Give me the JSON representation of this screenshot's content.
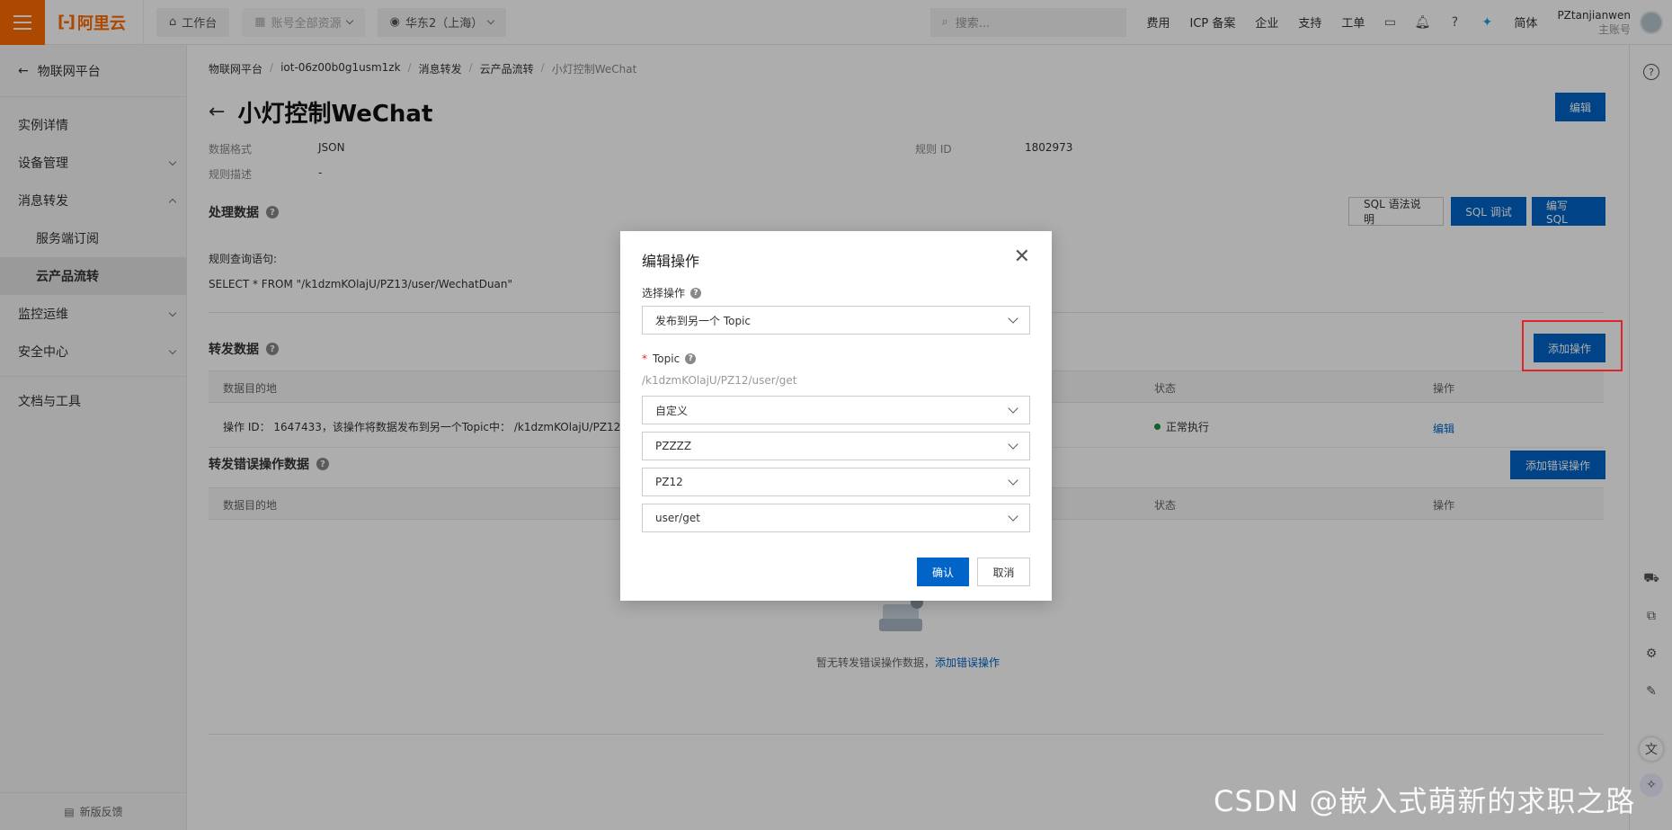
{
  "topbar": {
    "brand": "阿里云",
    "workbench": "工作台",
    "account_scope": "账号全部资源",
    "region": "华东2（上海）",
    "search_placeholder": "搜索...",
    "links": [
      "费用",
      "ICP 备案",
      "企业",
      "支持",
      "工单"
    ],
    "lang": "简体",
    "username": "PZtanjianwen",
    "account_type": "主账号"
  },
  "sidebar": {
    "back_label": "物联网平台",
    "items": [
      {
        "label": "实例详情"
      },
      {
        "label": "设备管理"
      },
      {
        "label": "消息转发"
      },
      {
        "label": "服务端订阅"
      },
      {
        "label": "云产品流转"
      },
      {
        "label": "监控运维"
      },
      {
        "label": "安全中心"
      },
      {
        "label": "文档与工具"
      }
    ],
    "feedback": "新版反馈"
  },
  "breadcrumb": [
    "物联网平台",
    "iot-06z00b0g1usm1zk",
    "消息转发",
    "云产品流转",
    "小灯控制WeChat"
  ],
  "page": {
    "title": "小灯控制WeChat",
    "edit_button": "编辑",
    "data_format_label": "数据格式",
    "data_format_value": "JSON",
    "rule_id_label": "规则 ID",
    "rule_id_value": "1802973",
    "rule_desc_label": "规则描述",
    "rule_desc_value": "-",
    "process_title": "处理数据",
    "sql_help": "SQL 语法说明",
    "sql_debug": "SQL 调试",
    "sql_write": "编写 SQL",
    "query_label": "规则查询语句:",
    "query_value": "SELECT * FROM \"/k1dzmKOlajU/PZ13/user/WechatDuan\"",
    "forward_title": "转发数据",
    "add_action": "添加操作",
    "col_dest": "数据目的地",
    "col_status": "状态",
    "col_ops": "操作",
    "row_text": "操作 ID： 1647433，该操作将数据发布到另一个Topic中： /k1dzmKOlajU/PZ12/user",
    "row_status": "正常执行",
    "row_edit": "编辑",
    "error_title": "转发错误操作数据",
    "add_error_action": "添加错误操作",
    "empty_text": "暂无转发错误操作数据，",
    "empty_link": "添加错误操作"
  },
  "modal": {
    "title": "编辑操作",
    "select_op_label": "选择操作",
    "select_op_value": "发布到另一个 Topic",
    "topic_label": "Topic",
    "topic_hint": "/k1dzmKOlajU/PZ12/user/get",
    "topic_type": "自定义",
    "product": "PZZZZ",
    "device": "PZ12",
    "topic_path": "user/get",
    "confirm": "确认",
    "cancel": "取消"
  },
  "watermark": "CSDN @嵌入式萌新的求职之路",
  "colors": {
    "brand": "#ff6a00",
    "primary": "#0064c8",
    "highlight": "#e0242b",
    "status_ok": "#1e8e3e"
  }
}
